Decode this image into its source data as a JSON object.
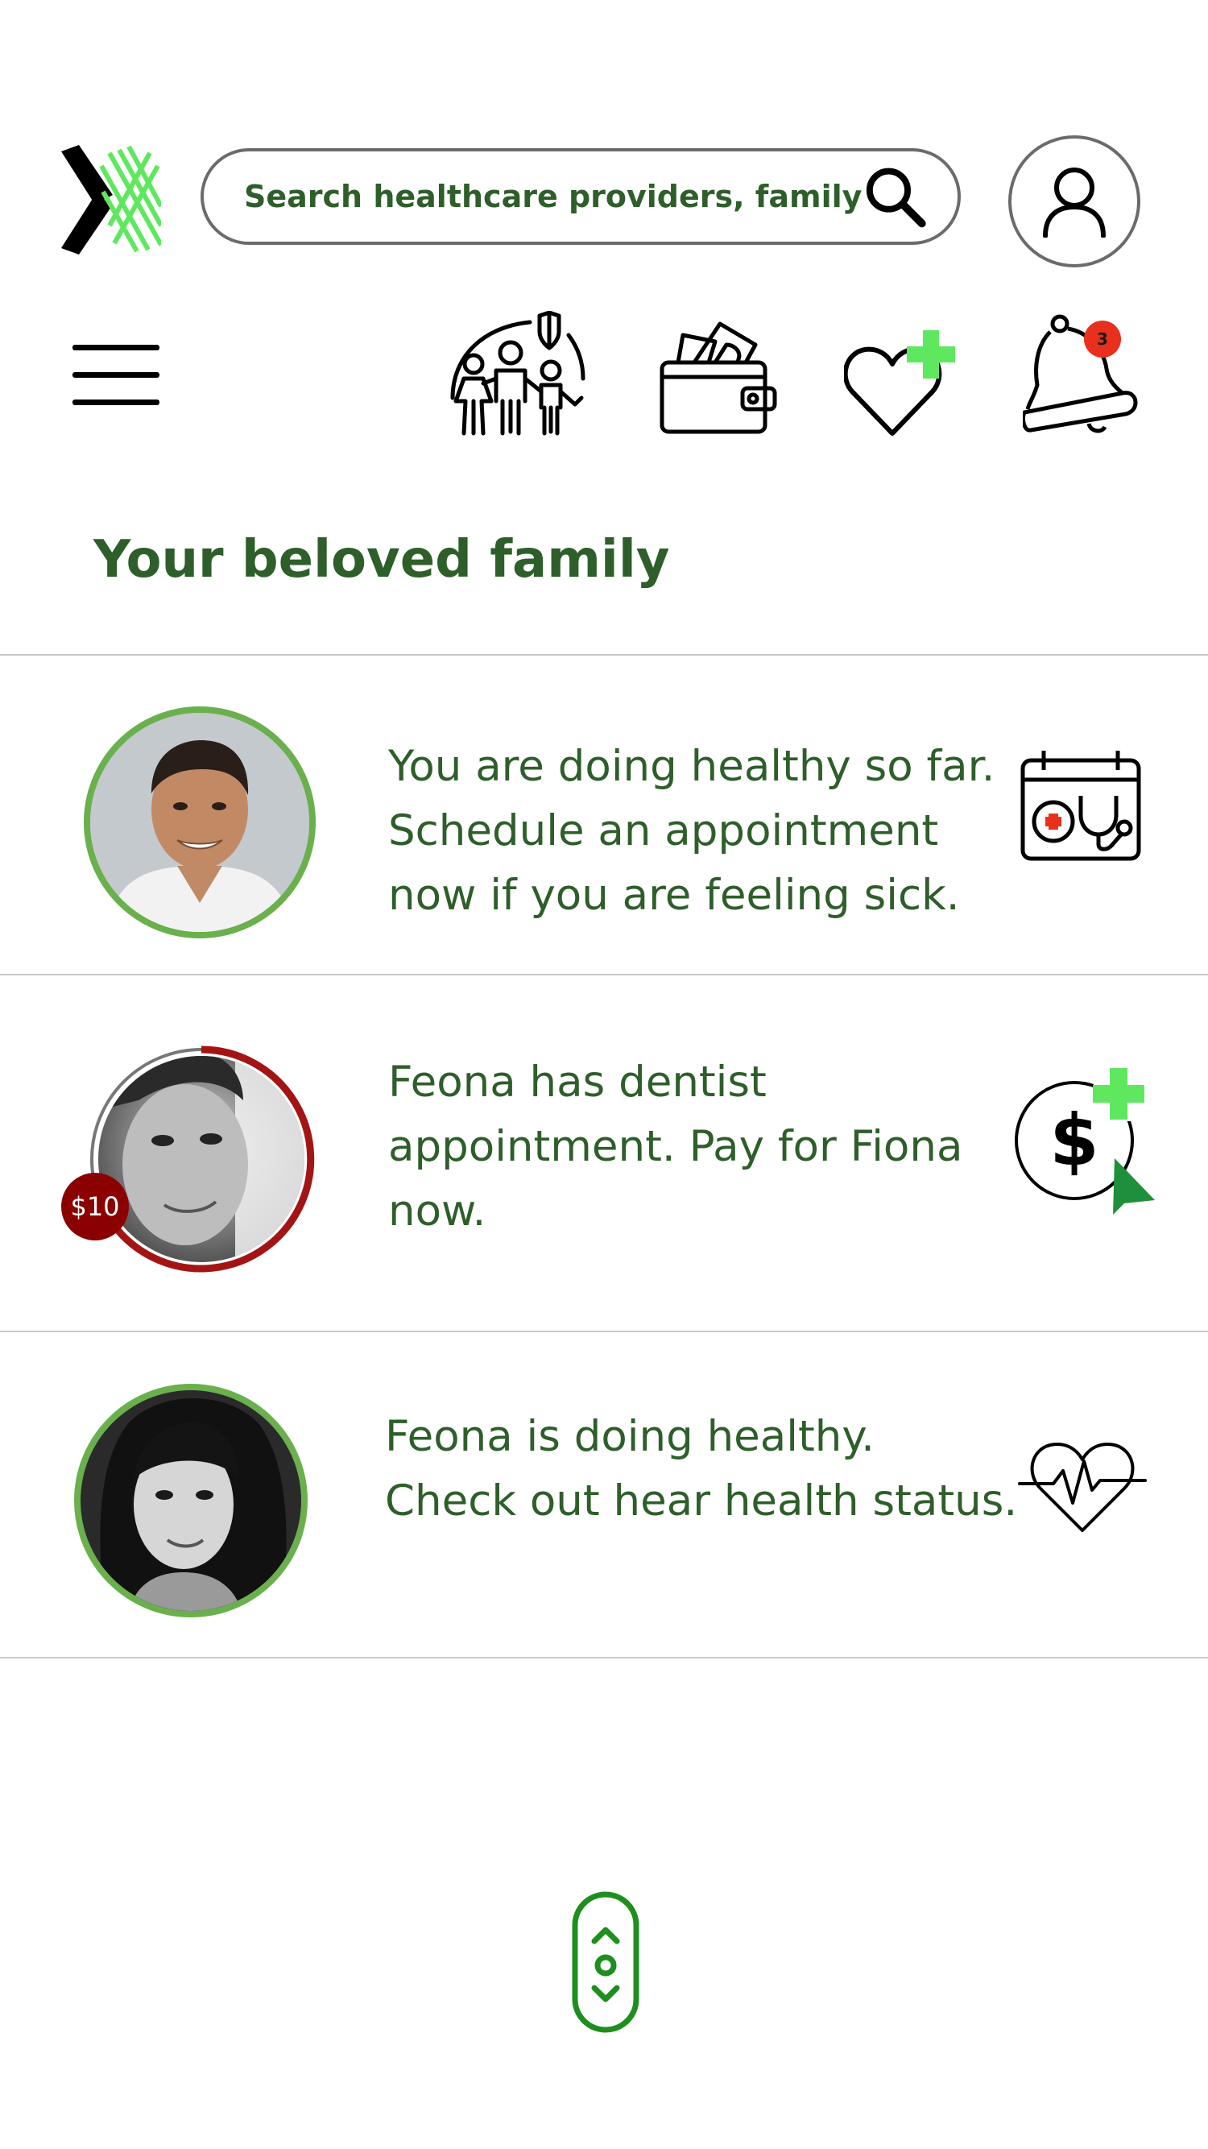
{
  "search": {
    "placeholder": "Search healthcare providers, family"
  },
  "header": {
    "section_title": "Your beloved family"
  },
  "notifications": {
    "count": "3"
  },
  "family": [
    {
      "message": [
        "You are doing healthy so far.",
        "Schedule an appointment",
        "now if you are feeling sick."
      ],
      "ring_color": "#6ab04c",
      "action_icon": "calendar-stethoscope-icon"
    },
    {
      "message": [
        "Feona has dentist",
        "appointment. Pay for Fiona",
        "now."
      ],
      "ring_color": "#a31515",
      "payment_due_fraction": 0.9,
      "badge": "$10",
      "action_icon": "pay-plus-icon"
    },
    {
      "message": [
        "Feona is doing healthy.",
        "Check out hear health status."
      ],
      "ring_color": "#6ab04c",
      "action_icon": "heartbeat-icon"
    }
  ],
  "colors": {
    "text_green": "#2e5e2a",
    "accent_green": "#5fe85f",
    "alert_red": "#e8301c",
    "badge_red": "#8b0000"
  }
}
